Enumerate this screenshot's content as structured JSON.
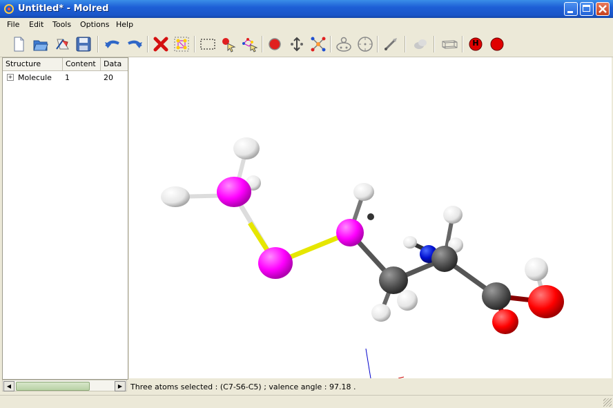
{
  "window": {
    "title": "Untitled* - Molred"
  },
  "menu": [
    "File",
    "Edit",
    "Tools",
    "Options",
    "Help"
  ],
  "toolbar": {
    "buttons": [
      "new-file",
      "open-folder",
      "open-recent",
      "save",
      "undo",
      "redo",
      "delete",
      "select-all-atoms",
      "box-select",
      "pick-atom",
      "pick-fragment",
      "add-atom",
      "move-atom",
      "add-bond",
      "rotate-fragment",
      "rotate-view",
      "measure-tool",
      "render-style",
      "toggle-cell",
      "add-hydrogens",
      "color-atoms"
    ],
    "hydrogen_label": "H"
  },
  "tree": {
    "columns": [
      "Structure",
      "Content",
      "Data"
    ],
    "rows": [
      {
        "name": "Molecule",
        "content": "1",
        "data": "20"
      }
    ]
  },
  "status": {
    "text": "Three atoms selected : (C7-S6-C5) ; valence angle :  97.18 ."
  },
  "colors": {
    "carbon": "#555555",
    "sulfur": "#ff00ff",
    "nitrogen": "#0000cc",
    "oxygen": "#ff0000",
    "hydrogen": "#ffffff",
    "sulfur_bond": "#e6e600"
  }
}
